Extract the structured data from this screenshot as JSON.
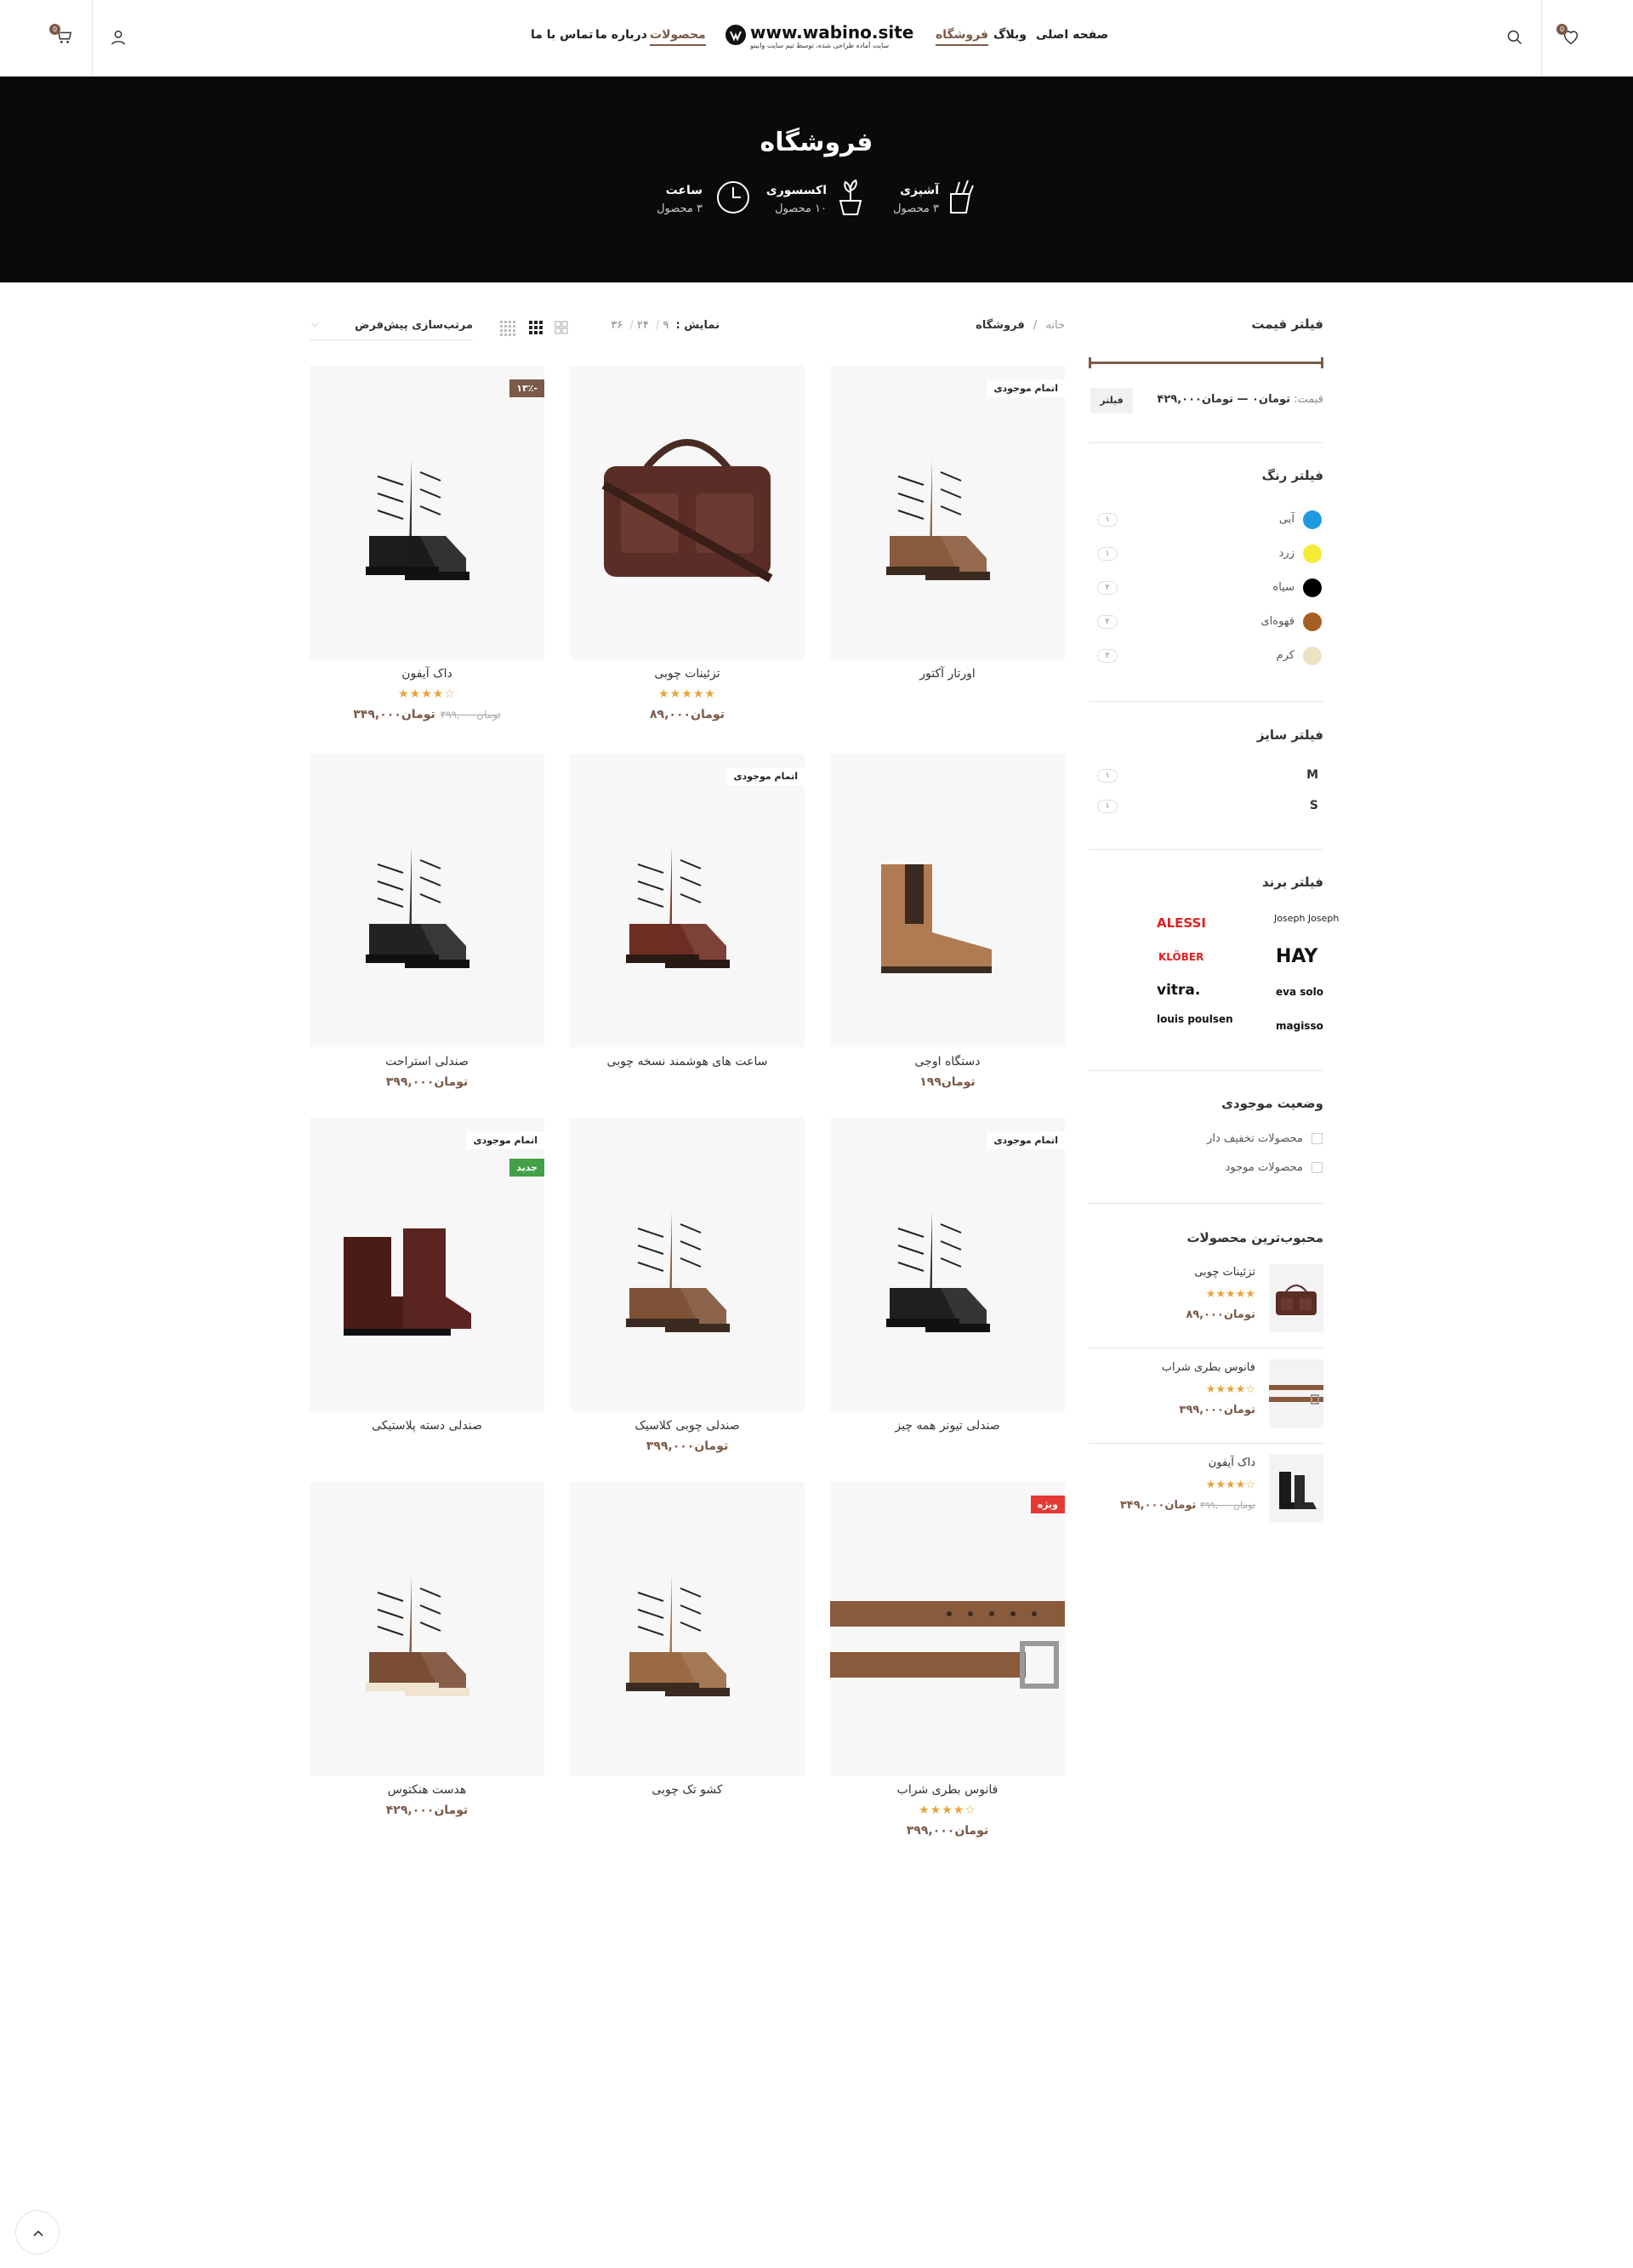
{
  "header": {
    "nav": [
      "صفحه اصلی",
      "وبلاگ",
      "فروشگاه",
      "محصولات",
      "درباره ما",
      "تماس با ما"
    ],
    "logo": {
      "text": "www.wabino.site",
      "sub": "سایت آماده طراحی شده، توسط تیم سایت وابینو"
    },
    "wishlist_count": "0",
    "cart_count": "0"
  },
  "hero": {
    "title": "فروشگاه",
    "categories": [
      {
        "name": "آشپزی",
        "count": "۳ محصول",
        "icon": "knife-block-icon"
      },
      {
        "name": "اکسسوری",
        "count": "۱۰ محصول",
        "icon": "plant-pot-icon"
      },
      {
        "name": "ساعت",
        "count": "۳ محصول",
        "icon": "clock-icon"
      }
    ]
  },
  "toolbar": {
    "breadcrumb_home": "خانه",
    "breadcrumb_sep": "/",
    "breadcrumb_current": "فروشگاه",
    "show_label": "نمایش :",
    "show_options": [
      "۹",
      "۲۴",
      "۳۶"
    ],
    "sort_label": "مرتب‌سازی پیش‌فرض"
  },
  "sidebar": {
    "price_filter": {
      "title": "فیلتر قیمت",
      "label": "قیمت:",
      "range": "تومان۰ — تومان۴۲۹,۰۰۰",
      "button": "فیلتر"
    },
    "color_filter": {
      "title": "فیلتر رنگ",
      "items": [
        {
          "name": "آبی",
          "count": "۱",
          "color": "#1e9be0"
        },
        {
          "name": "زرد",
          "count": "۱",
          "color": "#f5ec3a"
        },
        {
          "name": "سیاه",
          "count": "۲",
          "color": "#000000"
        },
        {
          "name": "قهوه‌ای",
          "count": "۲",
          "color": "#a65f22"
        },
        {
          "name": "کرم",
          "count": "۲",
          "color": "#ece3c2"
        }
      ]
    },
    "size_filter": {
      "title": "فیلتر سایز",
      "items": [
        {
          "name": "M",
          "count": "۱"
        },
        {
          "name": "S",
          "count": "۱"
        }
      ]
    },
    "brand_filter": {
      "title": "فیلتر برند",
      "brands": [
        "Joseph Joseph",
        "ALESSI",
        "HAY",
        "KLÖBER",
        "eva solo",
        "vitra.",
        "magisso",
        "louis poulsen"
      ]
    },
    "stock_filter": {
      "title": "وضعیت موجودی",
      "items": [
        "محصولات تخفیف دار",
        "محصولات موجود"
      ]
    },
    "popular": {
      "title": "محبوب‌ترین محصولات",
      "items": [
        {
          "name": "تزئینات چوبی",
          "stars": "★★★★★",
          "price": "تومان۸۹,۰۰۰",
          "old": ""
        },
        {
          "name": "فانوس بطری شراب",
          "stars": "★★★★☆",
          "price": "تومان۳۹۹,۰۰۰",
          "old": ""
        },
        {
          "name": "داک آیفون",
          "stars": "★★★★☆",
          "price": "تومان۳۴۹,۰۰۰",
          "old": "تومان۳۹۹,۰۰۰"
        }
      ]
    }
  },
  "products": [
    {
      "name": "اورتار آکتور",
      "stars": "",
      "price": "",
      "old": "",
      "label": "اتمام موجودی",
      "label2": "",
      "img": "brown-suede-boot"
    },
    {
      "name": "تزئینات چوبی",
      "stars": "★★★★★",
      "price": "تومان۸۹,۰۰۰",
      "old": "",
      "label": "",
      "label2": "",
      "img": "leather-bag"
    },
    {
      "name": "داک آیفون",
      "stars": "★★★★☆",
      "price": "تومان۳۴۹,۰۰۰",
      "old": "تومان۳۹۹,۰۰۰",
      "label": "-۱۳٪",
      "label2": "",
      "img": "black-combat-boot"
    },
    {
      "name": "دستگاه اوجی",
      "stars": "",
      "price": "تومان۱۹۹",
      "old": "",
      "label": "",
      "label2": "",
      "img": "tan-chelsea-boot"
    },
    {
      "name": "ساعت های هوشمند نسخه چوبی",
      "stars": "",
      "price": "",
      "old": "",
      "label": "اتمام موجودی",
      "label2": "",
      "img": "brown-brogue-boot"
    },
    {
      "name": "صندلی استراحت",
      "stars": "",
      "price": "تومان۳۹۹,۰۰۰",
      "old": "",
      "label": "",
      "label2": "",
      "img": "black-brogue-boot"
    },
    {
      "name": "صندلی تیونر همه چیز",
      "stars": "",
      "price": "",
      "old": "",
      "label": "اتمام موجودی",
      "label2": "",
      "img": "black-lace-boot"
    },
    {
      "name": "صندلی چوبی کلاسیک",
      "stars": "",
      "price": "تومان۳۹۹,۰۰۰",
      "old": "",
      "label": "",
      "label2": "",
      "img": "brown-suede-boot-2"
    },
    {
      "name": "صندلی دسته پلاستیکی",
      "stars": "",
      "price": "",
      "old": "",
      "label": "اتمام موجودی",
      "label2": "جدید",
      "img": "burgundy-chelsea-boot"
    },
    {
      "name": "فانوس بطری شراب",
      "stars": "★★★★☆",
      "price": "تومان۳۹۹,۰۰۰",
      "old": "",
      "label": "ویژه",
      "label2": "",
      "img": "leather-belt"
    },
    {
      "name": "کشو تک چوبی",
      "stars": "",
      "price": "",
      "old": "",
      "label": "",
      "label2": "",
      "img": "light-brown-boot"
    },
    {
      "name": "هدست هنکتوس",
      "stars": "",
      "price": "تومان۴۲۹,۰۰۰",
      "old": "",
      "label": "",
      "label2": "",
      "img": "suede-crepe-boot"
    }
  ],
  "colors": {
    "accent": "#7b5a48",
    "hero_bg": "#0a0a0a",
    "star": "#e8a33a"
  }
}
